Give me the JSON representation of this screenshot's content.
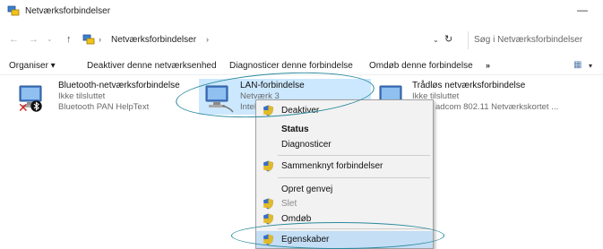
{
  "window": {
    "title": "Netværksforbindelser",
    "minimize_glyph": "—"
  },
  "address": {
    "crumb": "Netværksforbindelser",
    "search_placeholder": "Søg i Netværksforbindelser"
  },
  "toolbar": {
    "organiser": "Organiser ▾",
    "deactivate": "Deaktiver denne netværksenhed",
    "diagnose": "Diagnosticer denne forbindelse",
    "rename": "Omdøb denne forbindelse",
    "more": "»"
  },
  "connections": [
    {
      "name": "Bluetooth-netværksforbindelse",
      "status": "Ikke tilsluttet",
      "device": "Bluetooth PAN HelpText"
    },
    {
      "name": "LAN-forbindelse",
      "status": "Netværk  3",
      "device": "Intel"
    },
    {
      "name": "Trådløs netværksforbindelse",
      "status": "Ikke tilsluttet",
      "device": "adcom 802.11 Netværkskortet ..."
    }
  ],
  "context_menu": {
    "items": [
      {
        "label": "Deaktiver"
      },
      {
        "label": "Status"
      },
      {
        "label": "Diagnosticer"
      },
      {
        "label": "Sammenknyt forbindelser"
      },
      {
        "label": "Opret genvej"
      },
      {
        "label": "Slet"
      },
      {
        "label": "Omdøb"
      },
      {
        "label": "Egenskaber"
      }
    ]
  },
  "colors": {
    "selection": "#cce8ff",
    "highlight_ring": "#2a8a9c",
    "shield_blue": "#3a6fc4",
    "shield_yellow": "#f2c21b"
  }
}
